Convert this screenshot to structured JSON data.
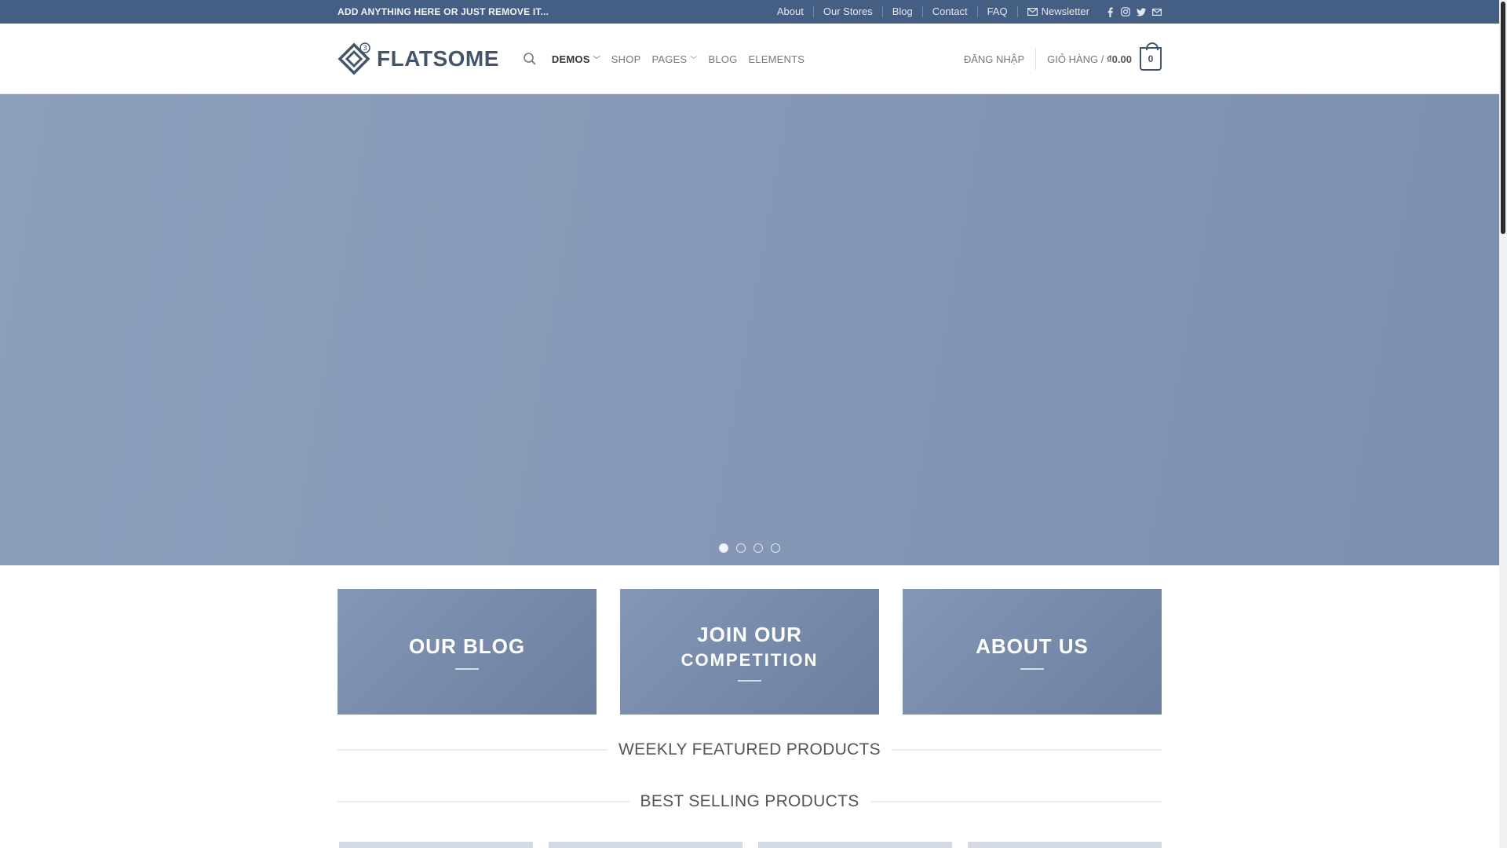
{
  "topbar": {
    "promo": "ADD ANYTHING HERE OR JUST REMOVE IT...",
    "links": [
      "About",
      "Our Stores",
      "Blog",
      "Contact",
      "FAQ"
    ],
    "newsletter": "Newsletter",
    "socials": [
      "facebook-icon",
      "instagram-icon",
      "twitter-icon",
      "email-icon"
    ],
    "bg_color": "#445e84"
  },
  "header": {
    "logo_text": "FLATSOME",
    "logo_badge": "3",
    "nav": [
      {
        "label": "DEMOS",
        "dropdown": true,
        "active": true
      },
      {
        "label": "SHOP",
        "dropdown": false,
        "active": false
      },
      {
        "label": "PAGES",
        "dropdown": true,
        "active": false
      },
      {
        "label": "BLOG",
        "dropdown": false,
        "active": false
      },
      {
        "label": "ELEMENTS",
        "dropdown": false,
        "active": false
      }
    ],
    "login": "ĐĂNG NHẬP",
    "cart_label": "GIỎ HÀNG /",
    "cart_total": "₫0.00",
    "cart_count": "0"
  },
  "hero": {
    "slides": 4,
    "active_slide": 1
  },
  "banners": [
    {
      "line1": "OUR BLOG",
      "line2": ""
    },
    {
      "line1": "JOIN OUR",
      "line2": "COMPETITION"
    },
    {
      "line1": "ABOUT US",
      "line2": ""
    }
  ],
  "sections": {
    "weekly": "WEEKLY FEATURED PRODUCTS",
    "best": "BEST SELLING PRODUCTS"
  }
}
